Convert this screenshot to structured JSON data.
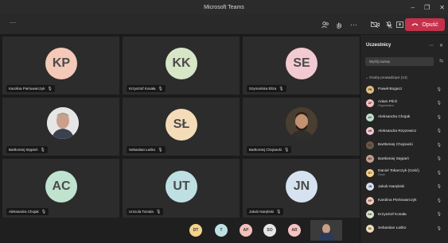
{
  "window": {
    "title": "Microsoft Teams",
    "controls": [
      "–",
      "❐",
      "✕"
    ]
  },
  "toolbar": {
    "timer": "----",
    "leave_label": "Opuść",
    "icons": [
      "people-icon",
      "raise-hand-icon",
      "more-icon",
      "camera-off-icon",
      "mic-off-icon",
      "share-icon"
    ]
  },
  "tiles": [
    {
      "name": "Karolina Pieńowarczyk",
      "initials": "KP",
      "color": "#f4c9b8"
    },
    {
      "name": "Krzysztof Kosała",
      "initials": "KK",
      "color": "#d8e6c8"
    },
    {
      "name": "Szymańska Eliza",
      "initials": "SE",
      "color": "#f3cad2"
    },
    {
      "name": "Bartłomiej Stępień",
      "initials": "",
      "color": "#d0d0d0"
    },
    {
      "name": "Sebastian Łaśko",
      "initials": "SŁ",
      "color": "#f4dcb8"
    },
    {
      "name": "Bartłomiej Chojnacki",
      "initials": "",
      "color": "#6a5a45"
    },
    {
      "name": "Aleksandra Chojak",
      "initials": "AC",
      "color": "#bfe3cf"
    },
    {
      "name": "Urszula Tomala",
      "initials": "UT",
      "color": "#bfe0e3"
    },
    {
      "name": "Jakub Narębski",
      "initials": "JN",
      "color": "#d6e2ef"
    }
  ],
  "overflow": [
    {
      "initials": "DT",
      "color": "#f6d28a"
    },
    {
      "initials": "T",
      "color": "#bfe0e3"
    },
    {
      "initials": "AP",
      "color": "#f4c0bc"
    },
    {
      "initials": "SO",
      "color": "#e6e6e6"
    },
    {
      "initials": "AR",
      "color": "#f6c3c0"
    }
  ],
  "panel": {
    "title": "Uczestnicy",
    "search_placeholder": "Wyślij nazwę",
    "section": "⌄ Osoby prowadzące (14)",
    "participants": [
      {
        "name": "Paweł Bogacz",
        "role": "",
        "initials": "PB",
        "color": "#e0c080"
      },
      {
        "name": "Adam Pilch",
        "role": "Organizator",
        "initials": "AP",
        "color": "#f4c0bc"
      },
      {
        "name": "Aleksandra Chojak",
        "role": "",
        "initials": "AC",
        "color": "#bfe3cf"
      },
      {
        "name": "Aleksandra Rzęzewicz",
        "role": "",
        "initials": "AR",
        "color": "#f3cad2"
      },
      {
        "name": "Bartłomiej Chojnacki",
        "role": "",
        "initials": "BC",
        "color": "#6a5a45"
      },
      {
        "name": "Bartłomiej Stępień",
        "role": "",
        "initials": "BS",
        "color": "#c8a090"
      },
      {
        "name": "Daniel Tokarczyk (Gość)",
        "role": "Gość",
        "initials": "DT",
        "color": "#f6d28a"
      },
      {
        "name": "Jakub Narębski",
        "role": "",
        "initials": "JN",
        "color": "#d6e2ef"
      },
      {
        "name": "Karolina Pieńowarczyk",
        "role": "",
        "initials": "KP",
        "color": "#f4c9b8"
      },
      {
        "name": "Krzysztof Kosała",
        "role": "",
        "initials": "KK",
        "color": "#d8e6c8"
      },
      {
        "name": "Sebastian Łaśko",
        "role": "",
        "initials": "SŁ",
        "color": "#f4dcb8"
      }
    ]
  }
}
